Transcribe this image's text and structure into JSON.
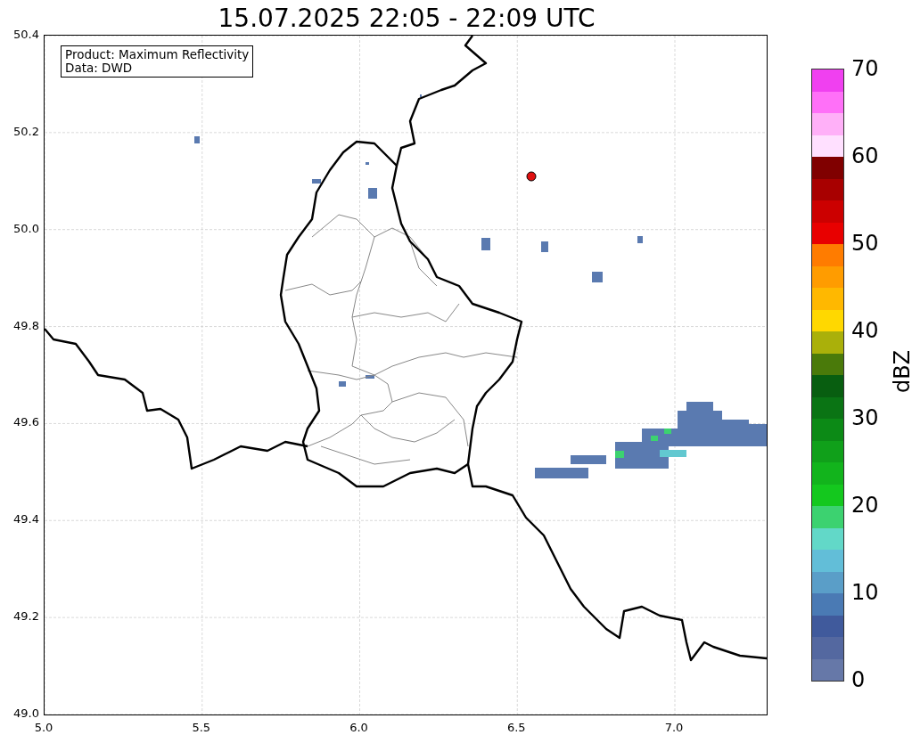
{
  "title": "15.07.2025 22:05 - 22:09 UTC",
  "info_box": {
    "lines": [
      "Product: Maximum Reflectivity",
      "Data: DWD"
    ]
  },
  "map": {
    "x_ticks": [
      "5.0",
      "5.5",
      "6.0",
      "6.5",
      "7.0"
    ],
    "y_ticks": [
      "50.4",
      "50.2",
      "50.0",
      "49.8",
      "49.6",
      "49.4",
      "49.2",
      "49.0"
    ]
  },
  "colorbar": {
    "label": "dBZ",
    "ticks": [
      "70",
      "60",
      "50",
      "40",
      "30",
      "20",
      "10",
      "0"
    ],
    "bins": [
      {
        "color": "#6678a8"
      },
      {
        "color": "#5468a0"
      },
      {
        "color": "#405a9c"
      },
      {
        "color": "#4a7ab4"
      },
      {
        "color": "#5a9ec8"
      },
      {
        "color": "#62bed8"
      },
      {
        "color": "#62d8c8"
      },
      {
        "color": "#3cd270"
      },
      {
        "color": "#14c81e"
      },
      {
        "color": "#12b41c"
      },
      {
        "color": "#10a01a"
      },
      {
        "color": "#0c8a16"
      },
      {
        "color": "#0a7414"
      },
      {
        "color": "#085e10"
      },
      {
        "color": "#4a7a0a"
      },
      {
        "color": "#aab00a"
      },
      {
        "color": "#ffd800"
      },
      {
        "color": "#ffb800"
      },
      {
        "color": "#ff9c00"
      },
      {
        "color": "#ff7c00"
      },
      {
        "color": "#e80000"
      },
      {
        "color": "#cc0000"
      },
      {
        "color": "#a80000"
      },
      {
        "color": "#800000"
      },
      {
        "color": "#ffe0ff"
      },
      {
        "color": "#ffb0f8"
      },
      {
        "color": "#ff70f8"
      },
      {
        "color": "#f040f0"
      }
    ]
  }
}
